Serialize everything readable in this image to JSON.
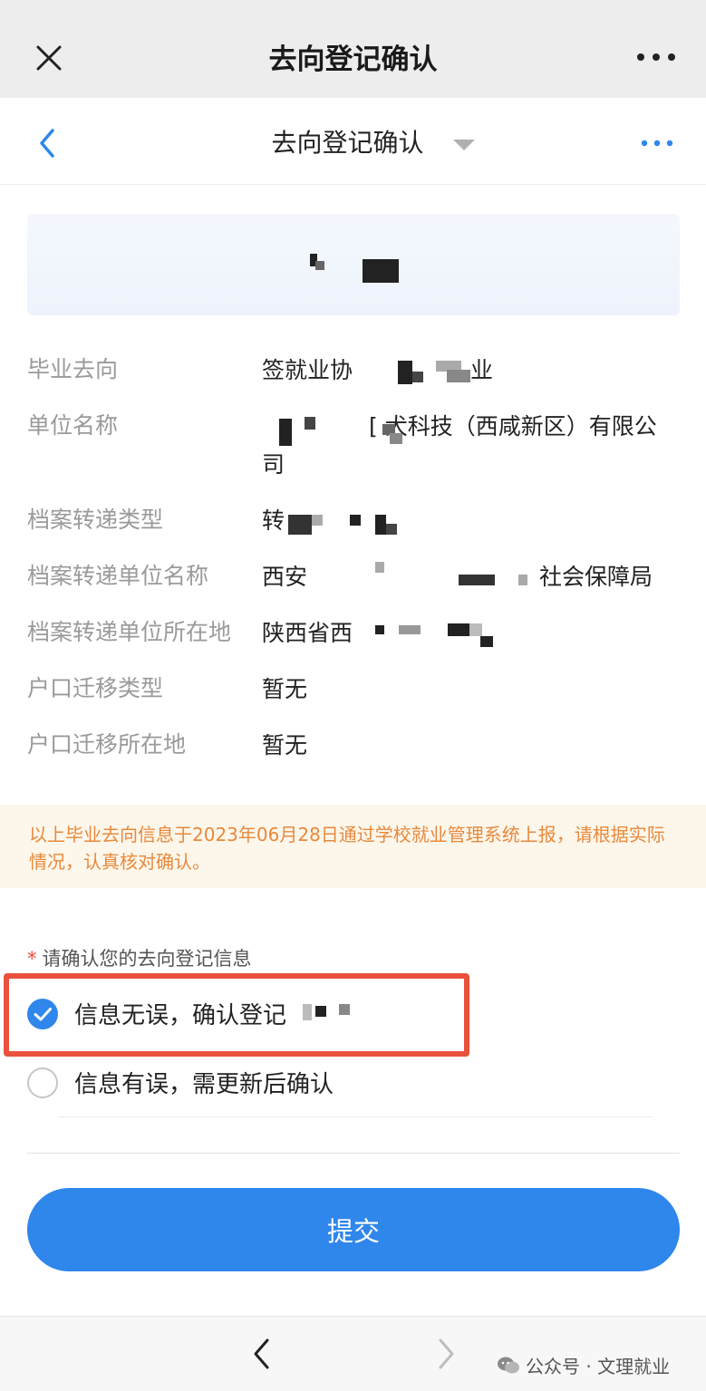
{
  "window": {
    "title": "去向登记确认"
  },
  "nav": {
    "title": "去向登记确认"
  },
  "info": {
    "rows": [
      {
        "label": "毕业去向",
        "value": "签就业协"
      },
      {
        "label": "单位名称",
        "value": "[   犬科技（西咸新区）有限公司"
      },
      {
        "label": "档案转递类型",
        "value": "转"
      },
      {
        "label": "档案转递单位名称",
        "value": "西安"
      },
      {
        "label": "档案转递单位所在地",
        "value": "陕西省西"
      },
      {
        "label": "户口迁移类型",
        "value": "暂无"
      },
      {
        "label": "户口迁移所在地",
        "value": "暂无"
      }
    ],
    "row1_suffix": "业",
    "row4_suffix": "社会保障局"
  },
  "notice": {
    "text": "以上毕业去向信息于2023年06月28日通过学校就业管理系统上报，请根据实际情况，认真核对确认。"
  },
  "confirm": {
    "required_mark": "*",
    "label": "请确认您的去向登记信息",
    "options": [
      {
        "label": "信息无误，确认登记",
        "checked": true
      },
      {
        "label": "信息有误，需更新后确认",
        "checked": false
      }
    ]
  },
  "submit": {
    "label": "提交"
  },
  "watermark": {
    "text": "公众号 · 文理就业"
  },
  "colors": {
    "accent": "#2f86eb",
    "notice_text": "#e8893c",
    "highlight": "#e9513d"
  }
}
